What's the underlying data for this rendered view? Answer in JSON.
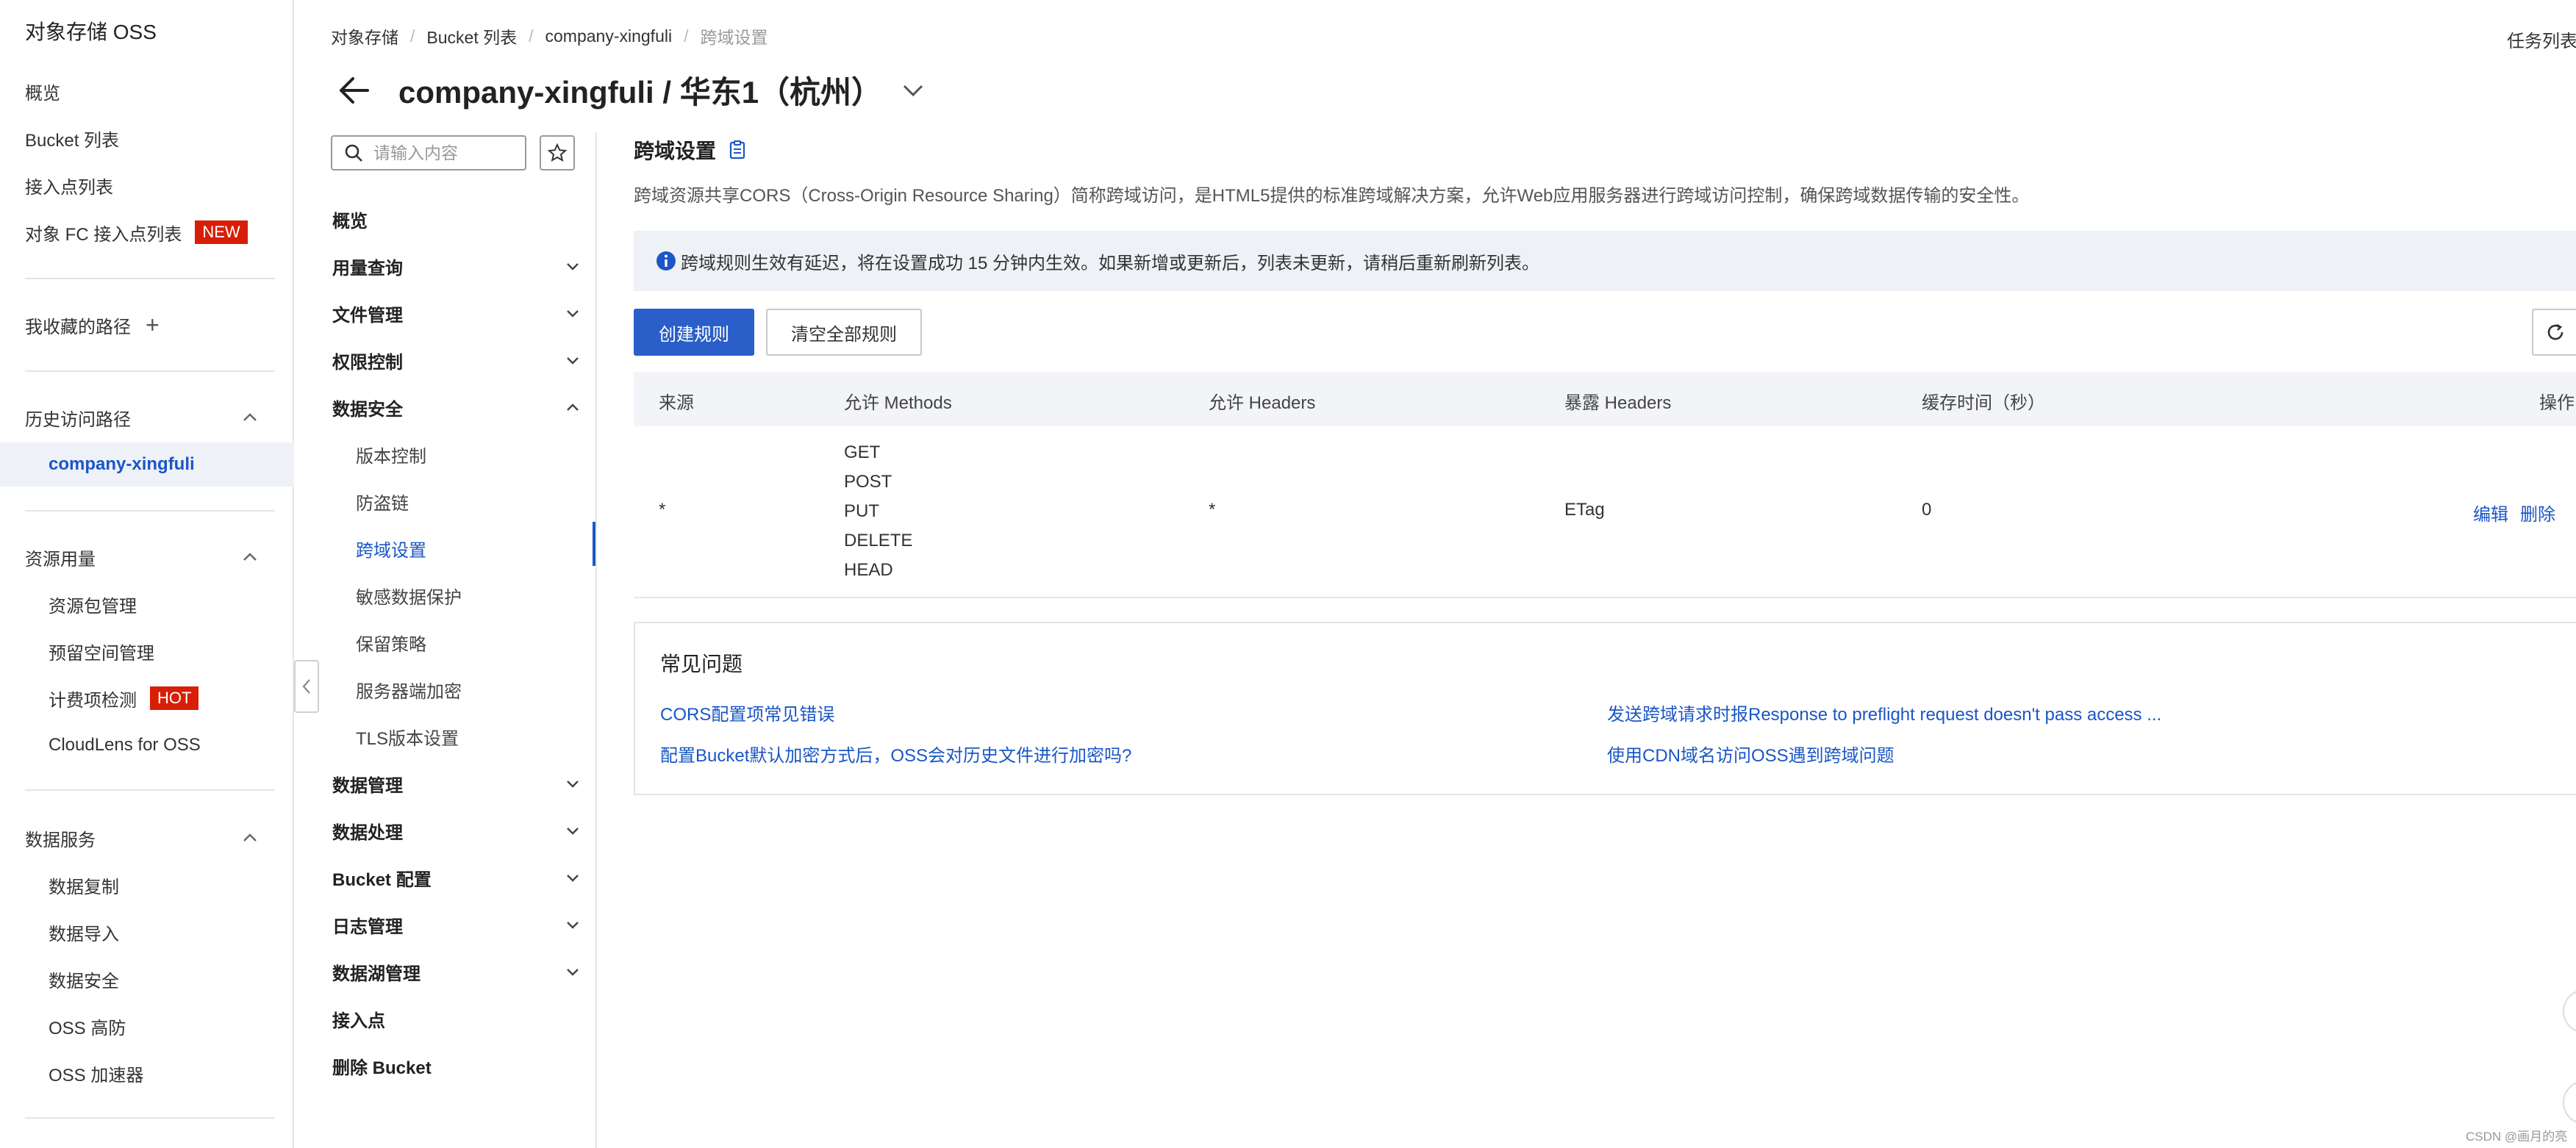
{
  "sidebar": {
    "title": "对象存储 OSS",
    "items": [
      {
        "label": "概览"
      },
      {
        "label": "Bucket 列表"
      },
      {
        "label": "接入点列表"
      },
      {
        "label": "对象 FC 接入点列表",
        "badge": "NEW"
      }
    ],
    "favorites_label": "我收藏的路径",
    "history": {
      "label": "历史访问路径",
      "items": [
        {
          "label": "company-xingfuli"
        }
      ]
    },
    "resources": {
      "label": "资源用量",
      "items": [
        {
          "label": "资源包管理"
        },
        {
          "label": "预留空间管理"
        },
        {
          "label": "计费项检测",
          "badge": "HOT"
        },
        {
          "label": "CloudLens for OSS"
        }
      ]
    },
    "data_services": {
      "label": "数据服务",
      "items": [
        {
          "label": "数据复制"
        },
        {
          "label": "数据导入"
        },
        {
          "label": "数据安全"
        },
        {
          "label": "OSS 高防"
        },
        {
          "label": "OSS 加速器"
        }
      ]
    }
  },
  "breadcrumb": [
    "对象存储",
    "Bucket 列表",
    "company-xingfuli",
    "跨域设置"
  ],
  "header": {
    "task_list": "任务列表",
    "title": "company-xingfuli / 华东1（杭州）"
  },
  "nav": {
    "search_placeholder": "请输入内容",
    "items": [
      {
        "label": "概览"
      },
      {
        "label": "用量查询"
      },
      {
        "label": "文件管理"
      },
      {
        "label": "权限控制"
      },
      {
        "label": "数据安全"
      },
      {
        "label": "版本控制"
      },
      {
        "label": "防盗链"
      },
      {
        "label": "跨域设置"
      },
      {
        "label": "敏感数据保护"
      },
      {
        "label": "保留策略"
      },
      {
        "label": "服务器端加密"
      },
      {
        "label": "TLS版本设置"
      },
      {
        "label": "数据管理"
      },
      {
        "label": "数据处理"
      },
      {
        "label": "Bucket 配置"
      },
      {
        "label": "日志管理"
      },
      {
        "label": "数据湖管理"
      },
      {
        "label": "接入点"
      },
      {
        "label": "删除 Bucket"
      }
    ]
  },
  "main": {
    "section_title": "跨域设置",
    "description": "跨域资源共享CORS（Cross-Origin Resource Sharing）简称跨域访问，是HTML5提供的标准跨域解决方案，允许Web应用服务器进行跨域访问控制，确保跨域数据传输的安全性。",
    "notice": "跨域规则生效有延迟，将在设置成功 15 分钟内生效。如果新增或更新后，列表未更新，请稍后重新刷新列表。",
    "create_button": "创建规则",
    "clear_button": "清空全部规则",
    "table": {
      "columns": [
        "来源",
        "允许 Methods",
        "允许 Headers",
        "暴露 Headers",
        "缓存时间（秒）",
        "操作"
      ],
      "rows": [
        {
          "origin": "*",
          "methods": [
            "GET",
            "POST",
            "PUT",
            "DELETE",
            "HEAD"
          ],
          "allow_headers": "*",
          "expose_headers": "ETag",
          "max_age": "0",
          "edit": "编辑",
          "delete": "删除"
        }
      ]
    },
    "faq": {
      "title": "常见问题",
      "links": [
        "CORS配置项常见错误",
        "发送跨域请求时报Response to preflight request doesn't pass access ...",
        "配置Bucket默认加密方式后，OSS会对历史文件进行加密吗?",
        "使用CDN域名访问OSS遇到跨域问题"
      ]
    }
  },
  "watermark": "CSDN @画月的亮",
  "colors": {
    "accent": "#2a5fc9",
    "link": "#1a56c6",
    "badge": "#d81e06",
    "notice_bg": "#eef1f6"
  }
}
